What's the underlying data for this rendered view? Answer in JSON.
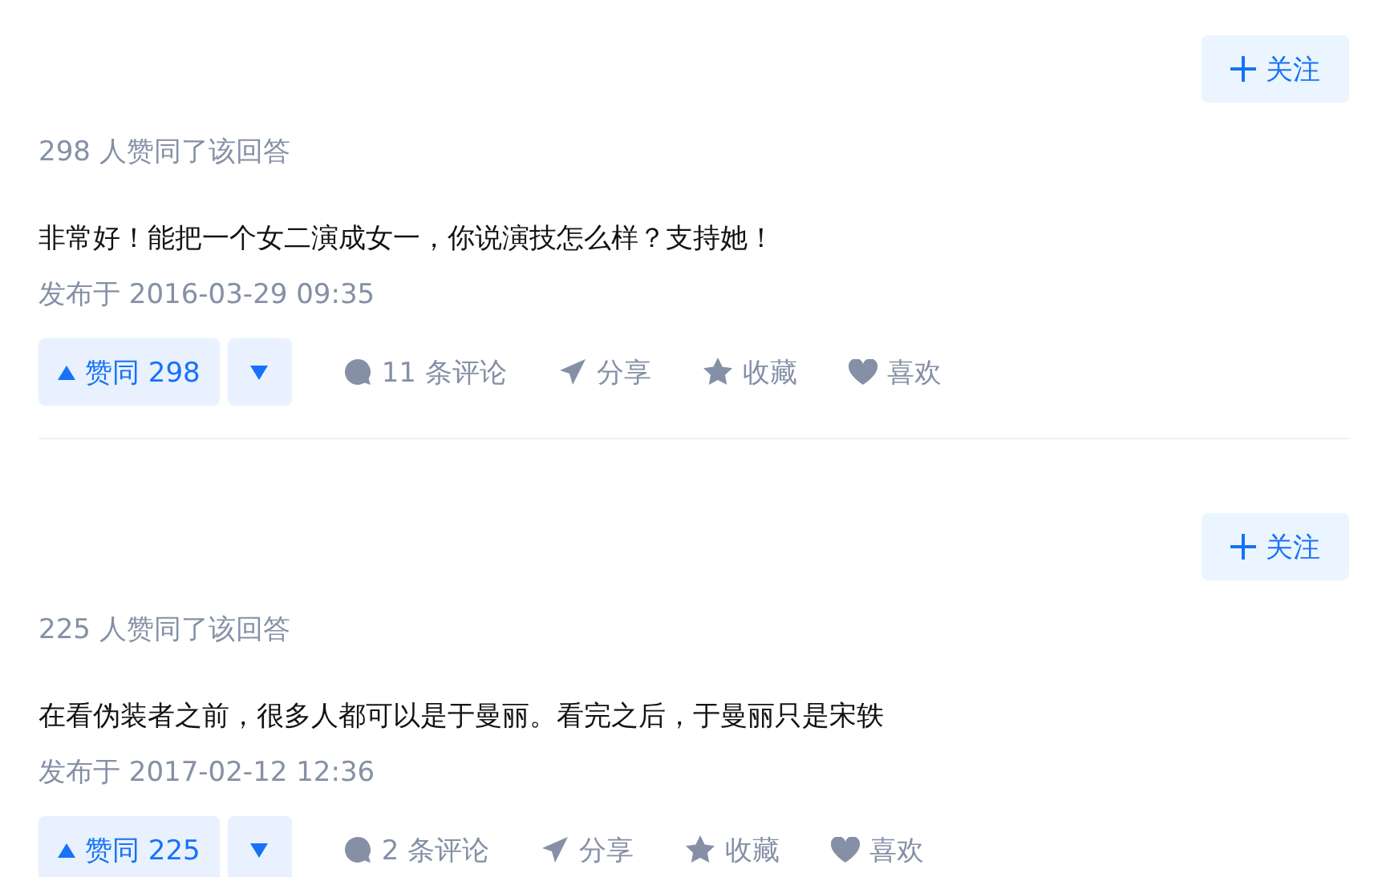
{
  "answers": [
    {
      "follow": "关注",
      "upvote_summary": "298 人赞同了该回答",
      "content": "非常好！能把一个女二演成女一，你说演技怎么样？支持她！",
      "published": "发布于 2016-03-29 09:35",
      "vote_up": "赞同 298",
      "actions": [
        {
          "kind": "comment",
          "label": "11 条评论"
        },
        {
          "kind": "share",
          "label": "分享"
        },
        {
          "kind": "favorite",
          "label": "收藏"
        },
        {
          "kind": "like",
          "label": "喜欢"
        }
      ]
    },
    {
      "follow": "关注",
      "upvote_summary": "225 人赞同了该回答",
      "content": "在看伪装者之前，很多人都可以是于曼丽。看完之后，于曼丽只是宋轶",
      "published": "发布于 2017-02-12 12:36",
      "vote_up": "赞同 225",
      "actions": [
        {
          "kind": "comment",
          "label": "2 条评论"
        },
        {
          "kind": "share",
          "label": "分享"
        },
        {
          "kind": "favorite",
          "label": "收藏"
        },
        {
          "kind": "like",
          "label": "喜欢"
        }
      ]
    }
  ]
}
